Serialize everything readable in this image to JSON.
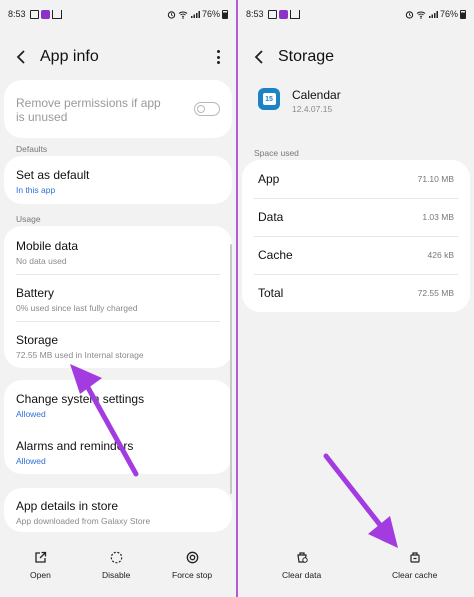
{
  "left": {
    "status": {
      "time": "8:53",
      "battery": "76%"
    },
    "appbar": {
      "title": "App info"
    },
    "remove_permissions": {
      "label": "Remove permissions if app is unused",
      "enabled": false
    },
    "sections": {
      "defaults": "Defaults",
      "usage": "Usage"
    },
    "set_as_default": {
      "label": "Set as default",
      "sub": "In this app"
    },
    "mobile_data": {
      "label": "Mobile data",
      "sub": "No data used"
    },
    "battery": {
      "label": "Battery",
      "sub": "0% used since last fully charged"
    },
    "storage": {
      "label": "Storage",
      "sub": "72.55 MB used in Internal storage"
    },
    "change_system_settings": {
      "label": "Change system settings",
      "sub": "Allowed"
    },
    "alarms": {
      "label": "Alarms and reminders",
      "sub": "Allowed"
    },
    "app_details": {
      "label": "App details in store",
      "sub": "App downloaded from Galaxy Store"
    },
    "bottom": {
      "open": "Open",
      "disable": "Disable",
      "force_stop": "Force stop"
    }
  },
  "right": {
    "status": {
      "time": "8:53",
      "battery": "76%"
    },
    "appbar": {
      "title": "Storage"
    },
    "app": {
      "name": "Calendar",
      "version": "12.4.07.15",
      "icon_text": "15"
    },
    "space_used_label": "Space used",
    "rows": [
      {
        "key": "App",
        "value": "71.10 MB"
      },
      {
        "key": "Data",
        "value": "1.03 MB"
      },
      {
        "key": "Cache",
        "value": "426 kB"
      },
      {
        "key": "Total",
        "value": "72.55 MB"
      }
    ],
    "bottom": {
      "clear_data": "Clear data",
      "clear_cache": "Clear cache"
    }
  },
  "colors": {
    "accent_arrow": "#a23be0",
    "link_blue": "#2f6fd6",
    "calendar_blue": "#1b82c5"
  }
}
